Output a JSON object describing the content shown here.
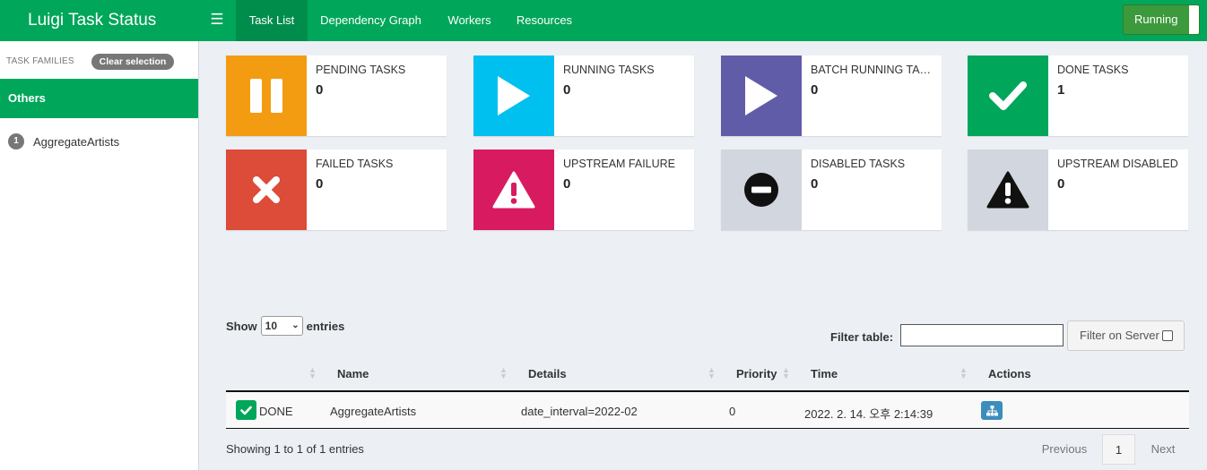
{
  "app": {
    "title": "Luigi Task Status",
    "status_button": "Running"
  },
  "nav": {
    "tabs": [
      {
        "label": "Task List",
        "active": true
      },
      {
        "label": "Dependency Graph"
      },
      {
        "label": "Workers"
      },
      {
        "label": "Resources"
      }
    ]
  },
  "sidebar": {
    "section_label": "TASK FAMILIES",
    "clear_label": "Clear selection",
    "group": "Others",
    "families": [
      {
        "count": "1",
        "name": "AggregateArtists"
      }
    ]
  },
  "infoboxes": [
    {
      "label": "PENDING TASKS",
      "count": "0",
      "icon": "pause-icon",
      "color": "#f39c12"
    },
    {
      "label": "RUNNING TASKS",
      "count": "0",
      "icon": "play-icon",
      "color": "#00c0ef"
    },
    {
      "label": "BATCH RUNNING TASKS",
      "count": "0",
      "icon": "play-icon",
      "color": "#605ca8"
    },
    {
      "label": "DONE TASKS",
      "count": "1",
      "icon": "check-icon",
      "color": "#00a65a"
    },
    {
      "label": "FAILED TASKS",
      "count": "0",
      "icon": "times-icon",
      "color": "#dd4b39"
    },
    {
      "label": "UPSTREAM FAILURE",
      "count": "0",
      "icon": "warning-icon",
      "color": "#d81b60"
    },
    {
      "label": "DISABLED TASKS",
      "count": "0",
      "icon": "minus-circle-icon",
      "color": "#d2d6de"
    },
    {
      "label": "UPSTREAM DISABLED",
      "count": "0",
      "icon": "warning-icon",
      "color": "#d2d6de"
    }
  ],
  "table": {
    "show_label": "Show",
    "page_size": "10",
    "entries_label": "entries",
    "filter_label": "Filter table:",
    "filter_value": "",
    "filter_server_label": "Filter on Server",
    "columns": [
      "Name",
      "Details",
      "Priority",
      "Time",
      "Actions"
    ],
    "rows": [
      {
        "status": "DONE",
        "name": "AggregateArtists",
        "details": "date_interval=2022-02",
        "priority": "0",
        "time": "2022. 2. 14. 오후 2:14:39"
      }
    ],
    "summary": "Showing 1 to 1 of 1 entries",
    "pagination": {
      "previous": "Previous",
      "current": "1",
      "next": "Next"
    }
  }
}
